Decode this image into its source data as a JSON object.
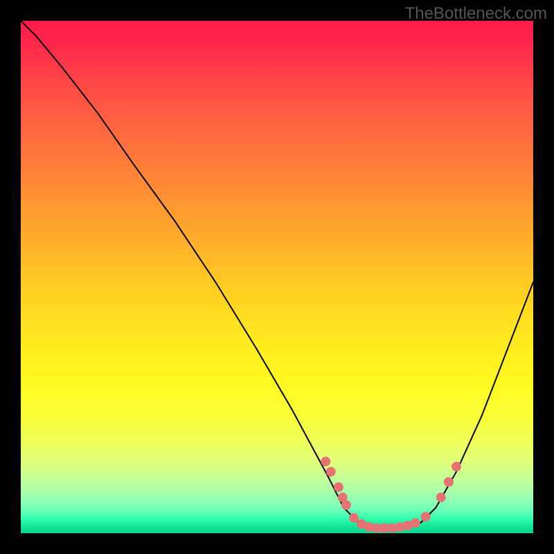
{
  "watermark": "TheBottleneck.com",
  "chart_data": {
    "type": "line",
    "title": "",
    "xlabel": "",
    "ylabel": "",
    "xlim": [
      0,
      100
    ],
    "ylim": [
      0,
      100
    ],
    "description": "V-shaped bottleneck curve over rainbow gradient (red high = bad, green low = good). Curve descends steeply from upper-left, flattens to a basin around x≈65–78, then rises toward the right edge.",
    "curve_points": [
      {
        "x": 0,
        "y": 100
      },
      {
        "x": 3,
        "y": 97
      },
      {
        "x": 8,
        "y": 91
      },
      {
        "x": 15,
        "y": 82
      },
      {
        "x": 22,
        "y": 72
      },
      {
        "x": 30,
        "y": 61
      },
      {
        "x": 38,
        "y": 49
      },
      {
        "x": 46,
        "y": 36
      },
      {
        "x": 53,
        "y": 24
      },
      {
        "x": 60,
        "y": 11
      },
      {
        "x": 63,
        "y": 5
      },
      {
        "x": 66,
        "y": 2
      },
      {
        "x": 70,
        "y": 1
      },
      {
        "x": 74,
        "y": 1
      },
      {
        "x": 78,
        "y": 2
      },
      {
        "x": 81,
        "y": 5
      },
      {
        "x": 85,
        "y": 12
      },
      {
        "x": 90,
        "y": 23
      },
      {
        "x": 95,
        "y": 36
      },
      {
        "x": 100,
        "y": 49
      }
    ],
    "marker_points": [
      {
        "x": 59.5,
        "y": 14
      },
      {
        "x": 60.5,
        "y": 12
      },
      {
        "x": 62,
        "y": 9
      },
      {
        "x": 62.8,
        "y": 7
      },
      {
        "x": 63.5,
        "y": 5.5
      },
      {
        "x": 65,
        "y": 3
      },
      {
        "x": 66.5,
        "y": 1.8
      },
      {
        "x": 68,
        "y": 1.2
      },
      {
        "x": 69.5,
        "y": 1
      },
      {
        "x": 71,
        "y": 1
      },
      {
        "x": 72.5,
        "y": 1
      },
      {
        "x": 74,
        "y": 1.2
      },
      {
        "x": 75.5,
        "y": 1.5
      },
      {
        "x": 77,
        "y": 2
      },
      {
        "x": 79,
        "y": 3.2
      },
      {
        "x": 82,
        "y": 7
      },
      {
        "x": 83.5,
        "y": 10
      },
      {
        "x": 85,
        "y": 13
      }
    ]
  }
}
